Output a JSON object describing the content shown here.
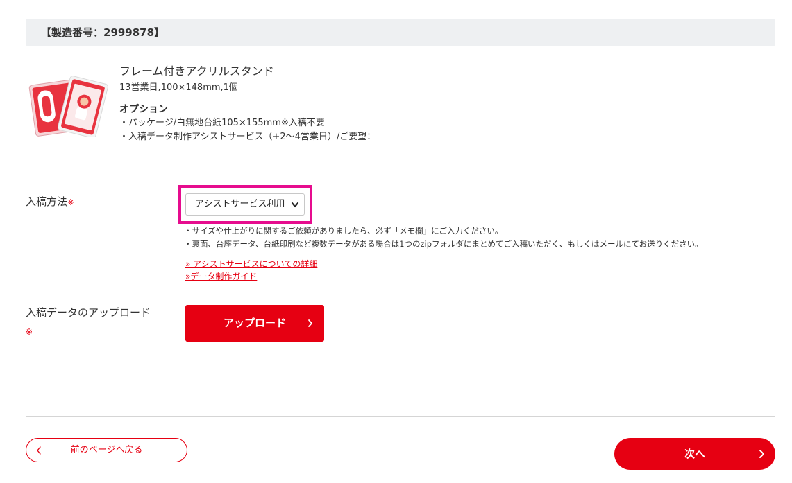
{
  "header": {
    "title": "【製造番号：2999878】"
  },
  "product": {
    "name": "フレーム付きアクリルスタンド",
    "spec": "13営業日,100×148mm,1個",
    "option_title": "オプション",
    "options": [
      "・パッケージ/白無地台紙105×155mm※入稿不要",
      "・入稿データ制作アシストサービス（+2〜4営業日）/ご要望："
    ]
  },
  "submission_method": {
    "label": "入稿方法",
    "required_mark": "※",
    "selected_value": "アシストサービス利用",
    "notes": [
      "・サイズや仕上がりに関するご依頼がありましたら、必ず「メモ欄」にご入力ください。",
      "・裏面、台座データ、台紙印刷など複数データがある場合は1つのzipフォルダにまとめてご入稿いただく、もしくはメールにてお送りください。"
    ],
    "links": [
      "» アシストサービスについての詳細",
      "»データ制作ガイド"
    ]
  },
  "upload": {
    "label": "入稿データのアップロード",
    "required_mark": "※",
    "button_label": "アップロード"
  },
  "footer": {
    "back_label": "前のページへ戻る",
    "next_label": "次へ"
  },
  "colors": {
    "accent": "#e60012",
    "highlight": "#e60c8e",
    "header_bg": "#eef0f2"
  }
}
